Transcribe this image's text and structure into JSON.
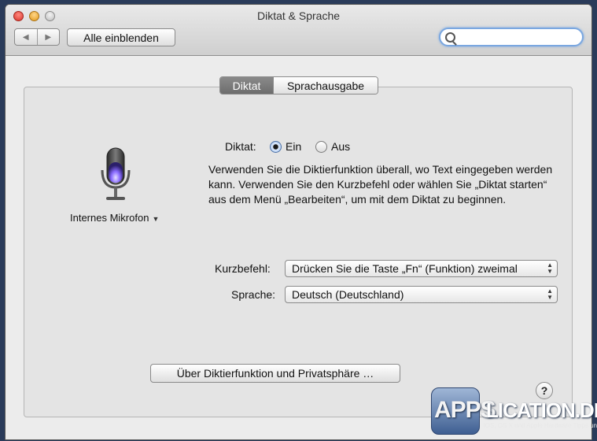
{
  "window": {
    "title": "Diktat & Sprache"
  },
  "toolbar": {
    "back_glyph": "◀",
    "forward_glyph": "▶",
    "show_all_label": "Alle einblenden",
    "search_value": "",
    "search_icon": "search-icon"
  },
  "tabs": [
    {
      "label": "Diktat",
      "active": true
    },
    {
      "label": "Sprachausgabe",
      "active": false
    }
  ],
  "microphone": {
    "icon": "microphone-icon",
    "label": "Internes Mikrofon",
    "dropdown_glyph": "▼"
  },
  "dictation": {
    "label": "Diktat:",
    "options": [
      {
        "label": "Ein",
        "selected": true
      },
      {
        "label": "Aus",
        "selected": false
      }
    ],
    "description": "Verwenden Sie die Diktierfunktion überall, wo Text eingegeben werden kann. Verwenden Sie den Kurzbefehl oder wählen Sie „Diktat starten“ aus dem Menü „Bearbeiten“, um mit dem Diktat zu beginnen."
  },
  "shortcut": {
    "label": "Kurzbefehl:",
    "value": "Drücken Sie die Taste „Fn“ (Funktion) zweimal"
  },
  "language": {
    "label": "Sprache:",
    "value": "Deutsch (Deutschland)"
  },
  "about_button": "Über Diktierfunktion und Privatsphäre …",
  "help_button": "?",
  "watermark": {
    "apps": "APPS",
    "rest": "LICATION.DE",
    "tagline": "iOS, OS X und Apple Hardware Tipps und Tests"
  },
  "colors": {
    "desktop": "#2a3b5a",
    "window_bg": "#ececec",
    "focus_ring": "#7aa7e0",
    "active_tab": "#7a7a7a",
    "mic_glow": "#8a6cff"
  }
}
